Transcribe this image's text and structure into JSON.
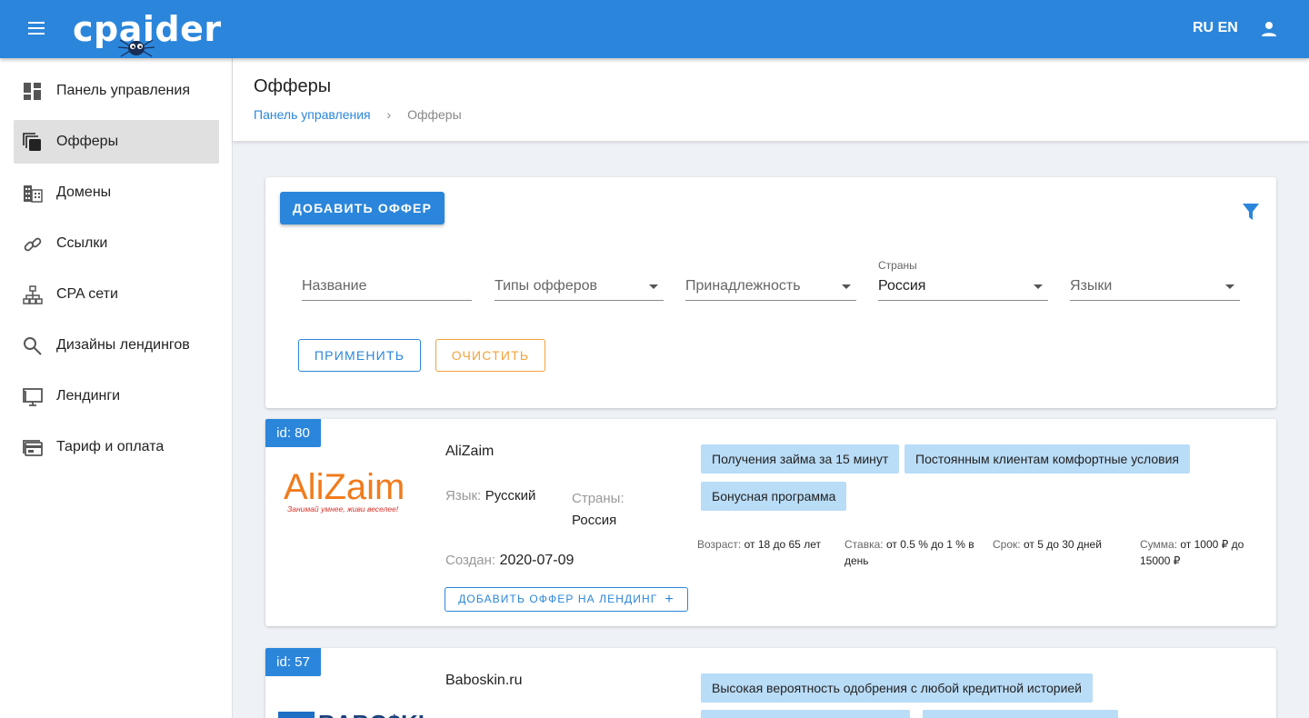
{
  "app": {
    "logo_text": "cpaider",
    "lang_ru": "RU",
    "lang_en": "EN"
  },
  "sidebar": {
    "items": [
      {
        "label": "Панель управления",
        "icon": "dashboard-icon"
      },
      {
        "label": "Офферы",
        "icon": "offers-icon",
        "active": true
      },
      {
        "label": "Домены",
        "icon": "domains-icon"
      },
      {
        "label": "Ссылки",
        "icon": "link-icon"
      },
      {
        "label": "CPA сети",
        "icon": "network-icon"
      },
      {
        "label": "Дизайны лендингов",
        "icon": "search-icon"
      },
      {
        "label": "Лендинги",
        "icon": "monitor-icon"
      },
      {
        "label": "Тариф и оплата",
        "icon": "payment-icon"
      }
    ]
  },
  "header": {
    "title": "Офферы",
    "breadcrumb": {
      "root": "Панель управления",
      "current": "Офферы"
    }
  },
  "filters": {
    "add_button": "ДОБАВИТЬ ОФФЕР",
    "name_placeholder": "Название",
    "offer_types_placeholder": "Типы офферов",
    "ownership_placeholder": "Принадлежность",
    "countries_label": "Страны",
    "countries_value": "Россия",
    "languages_placeholder": "Языки",
    "apply_button": "ПРИМЕНИТЬ",
    "clear_button": "ОЧИСТИТЬ"
  },
  "offers": [
    {
      "id": "id: 80",
      "name": "AliZaim",
      "logo_text": "AliZaim",
      "logo_tagline": "Занимай умнее, живи веселее!",
      "lang_label": "Язык:",
      "lang_value": "Русский",
      "countries_label": "Страны:",
      "countries_value": "Россия",
      "created_label": "Создан:",
      "created_value": "2020-07-09",
      "add_landing_button": "ДОБАВИТЬ ОФФЕР НА ЛЕНДИНГ",
      "tags": [
        "Получения займа за 15 минут",
        "Постоянным клиентам комфортные условия",
        "Бонусная программа"
      ],
      "conditions": {
        "age_label": "Возраст:",
        "age_value": "от 18 до 65 лет",
        "rate_label": "Ставка:",
        "rate_value": "от 0.5 % до 1 % в день",
        "term_label": "Срок:",
        "term_value": "от 5 до 30 дней",
        "sum_label": "Сумма:",
        "sum_value": "от 1000 ₽ до 15000 ₽"
      }
    },
    {
      "id": "id: 57",
      "name": "Baboskin.ru",
      "logo_text": "BABO$KIN",
      "tags": [
        "Высокая вероятность одобрения с любой кредитной историей"
      ]
    }
  ],
  "colors": {
    "primary": "#2b86db",
    "warning": "#f2a33a",
    "tag_bg": "#b9dcf7"
  }
}
